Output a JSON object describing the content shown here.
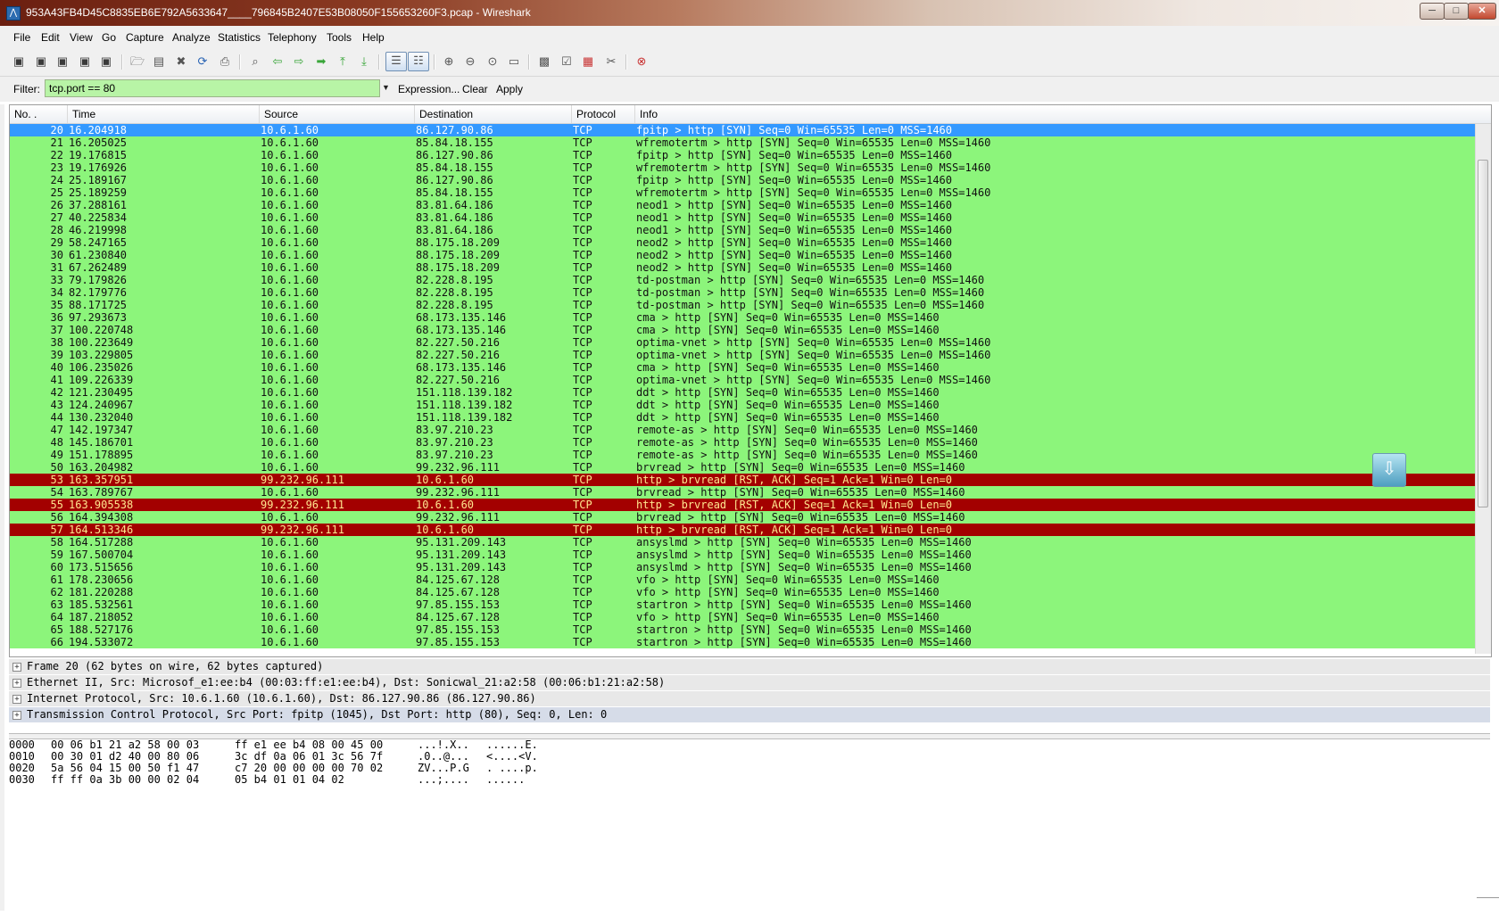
{
  "window": {
    "title": "953A43FB4D45C8835EB6E792A5633647____796845B2407E53B08050F155653260F3.pcap - Wireshark",
    "icon": "wireshark-icon",
    "minimize": "─",
    "maximize": "□",
    "close": "✕"
  },
  "menu": [
    "File",
    "Edit",
    "View",
    "Go",
    "Capture",
    "Analyze",
    "Statistics",
    "Telephony",
    "Tools",
    "Help"
  ],
  "filter": {
    "label": "Filter:",
    "value": "tcp.port == 80",
    "dropdown": "▼",
    "expression": "Expression...",
    "clear": "Clear",
    "apply": "Apply"
  },
  "columns": [
    "No. .",
    "Time",
    "Source",
    "Destination",
    "Protocol",
    "Info"
  ],
  "packets": [
    {
      "no": "20",
      "time": "16.204918",
      "src": "10.6.1.60",
      "dst": "86.127.90.86",
      "proto": "TCP",
      "info": "fpitp > http [SYN] Seq=0 Win=65535 Len=0 MSS=1460",
      "kind": "selected"
    },
    {
      "no": "21",
      "time": "16.205025",
      "src": "10.6.1.60",
      "dst": "85.84.18.155",
      "proto": "TCP",
      "info": "wfremotertm > http [SYN] Seq=0 Win=65535 Len=0 MSS=1460",
      "kind": "syn"
    },
    {
      "no": "22",
      "time": "19.176815",
      "src": "10.6.1.60",
      "dst": "86.127.90.86",
      "proto": "TCP",
      "info": "fpitp > http [SYN] Seq=0 Win=65535 Len=0 MSS=1460",
      "kind": "syn"
    },
    {
      "no": "23",
      "time": "19.176926",
      "src": "10.6.1.60",
      "dst": "85.84.18.155",
      "proto": "TCP",
      "info": "wfremotertm > http [SYN] Seq=0 Win=65535 Len=0 MSS=1460",
      "kind": "syn"
    },
    {
      "no": "24",
      "time": "25.189167",
      "src": "10.6.1.60",
      "dst": "86.127.90.86",
      "proto": "TCP",
      "info": "fpitp > http [SYN] Seq=0 Win=65535 Len=0 MSS=1460",
      "kind": "syn"
    },
    {
      "no": "25",
      "time": "25.189259",
      "src": "10.6.1.60",
      "dst": "85.84.18.155",
      "proto": "TCP",
      "info": "wfremotertm > http [SYN] Seq=0 Win=65535 Len=0 MSS=1460",
      "kind": "syn"
    },
    {
      "no": "26",
      "time": "37.288161",
      "src": "10.6.1.60",
      "dst": "83.81.64.186",
      "proto": "TCP",
      "info": "neod1 > http [SYN] Seq=0 Win=65535 Len=0 MSS=1460",
      "kind": "syn"
    },
    {
      "no": "27",
      "time": "40.225834",
      "src": "10.6.1.60",
      "dst": "83.81.64.186",
      "proto": "TCP",
      "info": "neod1 > http [SYN] Seq=0 Win=65535 Len=0 MSS=1460",
      "kind": "syn"
    },
    {
      "no": "28",
      "time": "46.219998",
      "src": "10.6.1.60",
      "dst": "83.81.64.186",
      "proto": "TCP",
      "info": "neod1 > http [SYN] Seq=0 Win=65535 Len=0 MSS=1460",
      "kind": "syn"
    },
    {
      "no": "29",
      "time": "58.247165",
      "src": "10.6.1.60",
      "dst": "88.175.18.209",
      "proto": "TCP",
      "info": "neod2 > http [SYN] Seq=0 Win=65535 Len=0 MSS=1460",
      "kind": "syn"
    },
    {
      "no": "30",
      "time": "61.230840",
      "src": "10.6.1.60",
      "dst": "88.175.18.209",
      "proto": "TCP",
      "info": "neod2 > http [SYN] Seq=0 Win=65535 Len=0 MSS=1460",
      "kind": "syn"
    },
    {
      "no": "31",
      "time": "67.262489",
      "src": "10.6.1.60",
      "dst": "88.175.18.209",
      "proto": "TCP",
      "info": "neod2 > http [SYN] Seq=0 Win=65535 Len=0 MSS=1460",
      "kind": "syn"
    },
    {
      "no": "33",
      "time": "79.179826",
      "src": "10.6.1.60",
      "dst": "82.228.8.195",
      "proto": "TCP",
      "info": "td-postman > http [SYN] Seq=0 Win=65535 Len=0 MSS=1460",
      "kind": "syn"
    },
    {
      "no": "34",
      "time": "82.179776",
      "src": "10.6.1.60",
      "dst": "82.228.8.195",
      "proto": "TCP",
      "info": "td-postman > http [SYN] Seq=0 Win=65535 Len=0 MSS=1460",
      "kind": "syn"
    },
    {
      "no": "35",
      "time": "88.171725",
      "src": "10.6.1.60",
      "dst": "82.228.8.195",
      "proto": "TCP",
      "info": "td-postman > http [SYN] Seq=0 Win=65535 Len=0 MSS=1460",
      "kind": "syn"
    },
    {
      "no": "36",
      "time": "97.293673",
      "src": "10.6.1.60",
      "dst": "68.173.135.146",
      "proto": "TCP",
      "info": "cma > http [SYN] Seq=0 Win=65535 Len=0 MSS=1460",
      "kind": "syn"
    },
    {
      "no": "37",
      "time": "100.220748",
      "src": "10.6.1.60",
      "dst": "68.173.135.146",
      "proto": "TCP",
      "info": "cma > http [SYN] Seq=0 Win=65535 Len=0 MSS=1460",
      "kind": "syn"
    },
    {
      "no": "38",
      "time": "100.223649",
      "src": "10.6.1.60",
      "dst": "82.227.50.216",
      "proto": "TCP",
      "info": "optima-vnet > http [SYN] Seq=0 Win=65535 Len=0 MSS=1460",
      "kind": "syn"
    },
    {
      "no": "39",
      "time": "103.229805",
      "src": "10.6.1.60",
      "dst": "82.227.50.216",
      "proto": "TCP",
      "info": "optima-vnet > http [SYN] Seq=0 Win=65535 Len=0 MSS=1460",
      "kind": "syn"
    },
    {
      "no": "40",
      "time": "106.235026",
      "src": "10.6.1.60",
      "dst": "68.173.135.146",
      "proto": "TCP",
      "info": "cma > http [SYN] Seq=0 Win=65535 Len=0 MSS=1460",
      "kind": "syn"
    },
    {
      "no": "41",
      "time": "109.226339",
      "src": "10.6.1.60",
      "dst": "82.227.50.216",
      "proto": "TCP",
      "info": "optima-vnet > http [SYN] Seq=0 Win=65535 Len=0 MSS=1460",
      "kind": "syn"
    },
    {
      "no": "42",
      "time": "121.230495",
      "src": "10.6.1.60",
      "dst": "151.118.139.182",
      "proto": "TCP",
      "info": "ddt > http [SYN] Seq=0 Win=65535 Len=0 MSS=1460",
      "kind": "syn"
    },
    {
      "no": "43",
      "time": "124.240967",
      "src": "10.6.1.60",
      "dst": "151.118.139.182",
      "proto": "TCP",
      "info": "ddt > http [SYN] Seq=0 Win=65535 Len=0 MSS=1460",
      "kind": "syn"
    },
    {
      "no": "44",
      "time": "130.232040",
      "src": "10.6.1.60",
      "dst": "151.118.139.182",
      "proto": "TCP",
      "info": "ddt > http [SYN] Seq=0 Win=65535 Len=0 MSS=1460",
      "kind": "syn"
    },
    {
      "no": "47",
      "time": "142.197347",
      "src": "10.6.1.60",
      "dst": "83.97.210.23",
      "proto": "TCP",
      "info": "remote-as > http [SYN] Seq=0 Win=65535 Len=0 MSS=1460",
      "kind": "syn"
    },
    {
      "no": "48",
      "time": "145.186701",
      "src": "10.6.1.60",
      "dst": "83.97.210.23",
      "proto": "TCP",
      "info": "remote-as > http [SYN] Seq=0 Win=65535 Len=0 MSS=1460",
      "kind": "syn"
    },
    {
      "no": "49",
      "time": "151.178895",
      "src": "10.6.1.60",
      "dst": "83.97.210.23",
      "proto": "TCP",
      "info": "remote-as > http [SYN] Seq=0 Win=65535 Len=0 MSS=1460",
      "kind": "syn"
    },
    {
      "no": "50",
      "time": "163.204982",
      "src": "10.6.1.60",
      "dst": "99.232.96.111",
      "proto": "TCP",
      "info": "brvread > http [SYN] Seq=0 Win=65535 Len=0 MSS=1460",
      "kind": "syn"
    },
    {
      "no": "53",
      "time": "163.357951",
      "src": "99.232.96.111",
      "dst": "10.6.1.60",
      "proto": "TCP",
      "info": "http > brvread [RST, ACK] Seq=1 Ack=1 Win=0 Len=0",
      "kind": "rst"
    },
    {
      "no": "54",
      "time": "163.789767",
      "src": "10.6.1.60",
      "dst": "99.232.96.111",
      "proto": "TCP",
      "info": "brvread > http [SYN] Seq=0 Win=65535 Len=0 MSS=1460",
      "kind": "syn"
    },
    {
      "no": "55",
      "time": "163.905538",
      "src": "99.232.96.111",
      "dst": "10.6.1.60",
      "proto": "TCP",
      "info": "http > brvread [RST, ACK] Seq=1 Ack=1 Win=0 Len=0",
      "kind": "rst"
    },
    {
      "no": "56",
      "time": "164.394308",
      "src": "10.6.1.60",
      "dst": "99.232.96.111",
      "proto": "TCP",
      "info": "brvread > http [SYN] Seq=0 Win=65535 Len=0 MSS=1460",
      "kind": "syn"
    },
    {
      "no": "57",
      "time": "164.513346",
      "src": "99.232.96.111",
      "dst": "10.6.1.60",
      "proto": "TCP",
      "info": "http > brvread [RST, ACK] Seq=1 Ack=1 Win=0 Len=0",
      "kind": "rst"
    },
    {
      "no": "58",
      "time": "164.517288",
      "src": "10.6.1.60",
      "dst": "95.131.209.143",
      "proto": "TCP",
      "info": "ansyslmd > http [SYN] Seq=0 Win=65535 Len=0 MSS=1460",
      "kind": "syn"
    },
    {
      "no": "59",
      "time": "167.500704",
      "src": "10.6.1.60",
      "dst": "95.131.209.143",
      "proto": "TCP",
      "info": "ansyslmd > http [SYN] Seq=0 Win=65535 Len=0 MSS=1460",
      "kind": "syn"
    },
    {
      "no": "60",
      "time": "173.515656",
      "src": "10.6.1.60",
      "dst": "95.131.209.143",
      "proto": "TCP",
      "info": "ansyslmd > http [SYN] Seq=0 Win=65535 Len=0 MSS=1460",
      "kind": "syn"
    },
    {
      "no": "61",
      "time": "178.230656",
      "src": "10.6.1.60",
      "dst": "84.125.67.128",
      "proto": "TCP",
      "info": "vfo > http [SYN] Seq=0 Win=65535 Len=0 MSS=1460",
      "kind": "syn"
    },
    {
      "no": "62",
      "time": "181.220288",
      "src": "10.6.1.60",
      "dst": "84.125.67.128",
      "proto": "TCP",
      "info": "vfo > http [SYN] Seq=0 Win=65535 Len=0 MSS=1460",
      "kind": "syn"
    },
    {
      "no": "63",
      "time": "185.532561",
      "src": "10.6.1.60",
      "dst": "97.85.155.153",
      "proto": "TCP",
      "info": "startron > http [SYN] Seq=0 Win=65535 Len=0 MSS=1460",
      "kind": "syn"
    },
    {
      "no": "64",
      "time": "187.218052",
      "src": "10.6.1.60",
      "dst": "84.125.67.128",
      "proto": "TCP",
      "info": "vfo > http [SYN] Seq=0 Win=65535 Len=0 MSS=1460",
      "kind": "syn"
    },
    {
      "no": "65",
      "time": "188.527176",
      "src": "10.6.1.60",
      "dst": "97.85.155.153",
      "proto": "TCP",
      "info": "startron > http [SYN] Seq=0 Win=65535 Len=0 MSS=1460",
      "kind": "syn"
    },
    {
      "no": "66",
      "time": "194.533072",
      "src": "10.6.1.60",
      "dst": "97.85.155.153",
      "proto": "TCP",
      "info": "startron > http [SYN] Seq=0 Win=65535 Len=0 MSS=1460",
      "kind": "syn"
    }
  ],
  "details": [
    {
      "text": "Frame 20 (62 bytes on wire, 62 bytes captured)",
      "selected": false
    },
    {
      "text": "Ethernet II, Src: Microsof_e1:ee:b4 (00:03:ff:e1:ee:b4), Dst: Sonicwal_21:a2:58 (00:06:b1:21:a2:58)",
      "selected": false
    },
    {
      "text": "Internet Protocol, Src: 10.6.1.60 (10.6.1.60), Dst: 86.127.90.86 (86.127.90.86)",
      "selected": false
    },
    {
      "text": "Transmission Control Protocol, Src Port: fpitp (1045), Dst Port: http (80), Seq: 0, Len: 0",
      "selected": true
    }
  ],
  "expander_symbol": "+",
  "hexdump": [
    {
      "offset": "0000",
      "bytes1": "00 06 b1 21 a2 58 00 03",
      "bytes2": "ff e1 ee b4 08 00 45 00",
      "ascii1": "...!.X..",
      "ascii2": "......E."
    },
    {
      "offset": "0010",
      "bytes1": "00 30 01 d2 40 00 80 06",
      "bytes2": "3c df 0a 06 01 3c 56 7f",
      "ascii1": ".0..@...",
      "ascii2": "<....<V."
    },
    {
      "offset": "0020",
      "bytes1": "5a 56 04 15 00 50 f1 47",
      "bytes2": "c7 20 00 00 00 00 70 02",
      "ascii1": "ZV...P.G",
      "ascii2": ". ....p."
    },
    {
      "offset": "0030",
      "bytes1": "ff ff 0a 3b 00 00 02 04",
      "bytes2": "05 b4 01 01 04 02",
      "ascii1": "...;....",
      "ascii2": "......"
    }
  ],
  "autoscroll_icon": "⇩",
  "colors": {
    "syn_row": "#8cf57b",
    "rst_row": "#a30000",
    "rst_text": "#ffe68f",
    "selected_row": "#3399ff",
    "filter_ok": "#b8f4a6"
  }
}
